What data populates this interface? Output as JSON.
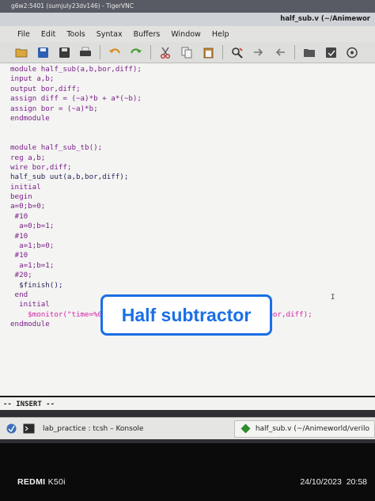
{
  "vnc_window": {
    "title": "g6w2:5401 (sumjuly23dv146) - TigerVNC"
  },
  "gvim_window": {
    "title": "half_sub.v (~/Animewor"
  },
  "menubar": [
    "File",
    "Edit",
    "Tools",
    "Syntax",
    "Buffers",
    "Window",
    "Help"
  ],
  "toolbar": [
    "open-icon",
    "save-icon",
    "save-all-icon",
    "print-icon",
    "undo-icon",
    "redo-icon",
    "cut-icon",
    "copy-icon",
    "paste-icon",
    "find-replace-icon",
    "find-next-icon",
    "find-prev-icon",
    "load-session-icon",
    "save-session-icon",
    "run-script-icon"
  ],
  "editor": {
    "lines": [
      "module half_sub(a,b,bor,diff);",
      "input a,b;",
      "output bor,diff;",
      "assign diff = (~a)*b + a*(~b);",
      "assign bor = (~a)*b;",
      "endmodule",
      "",
      "",
      "module half_sub_tb();",
      "reg a,b;",
      "wire bor,diff;",
      "half_sub uut(a,b,bor,diff);",
      "initial",
      "begin",
      "a=0;b=0;",
      " #10",
      "  a=0;b=1;",
      " #10",
      "  a=1;b=0;",
      " #10",
      "  a=1;b=1;",
      " #20;",
      "  $finish();",
      " end",
      "  initial",
      "    $monitor(\"time=%0t,a=%b,b=%b,bor=%b,diff=%b\",$time,a,b,bor,diff);",
      "endmodule"
    ],
    "tildes": [
      "~",
      "~",
      "~",
      "~"
    ],
    "mode": "-- INSERT --"
  },
  "overlay_caption": "Half subtractor",
  "taskbar": {
    "items": [
      {
        "label": "lab_practice : tcsh – Konsole"
      },
      {
        "label": "half_sub.v (~/Animeworld/verilo"
      }
    ]
  },
  "camera": {
    "brand": "REDMI",
    "model": "K50i",
    "date": "24/10/2023",
    "time": "20:58"
  },
  "colors": {
    "accent": "#1a6fe6",
    "keyword": "#7a1e8a",
    "string": "#d421a6",
    "code_text": "#27255c"
  }
}
